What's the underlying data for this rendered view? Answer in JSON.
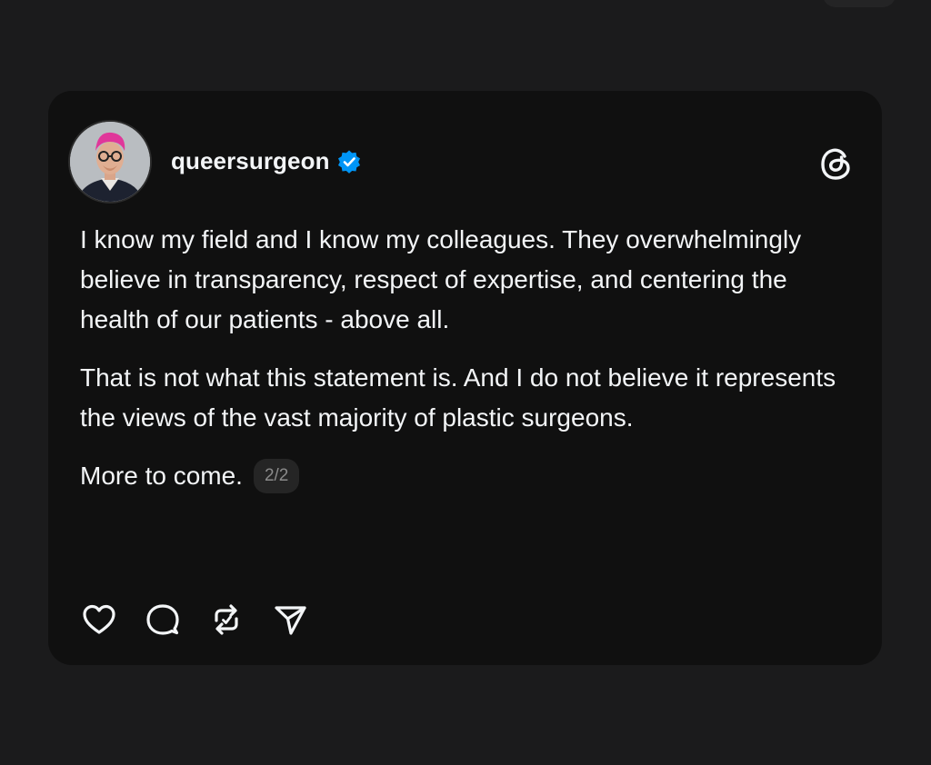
{
  "post": {
    "username": "queersurgeon",
    "verified": true,
    "paragraphs": [
      "I know my field and I know my colleagues. They overwhelmingly believe in transparency, respect of expertise, and centering the health of our patients - above all.",
      "That is not what this statement is. And I do not believe it represents the views of the vast majority of plastic surgeons."
    ],
    "last_line": "More to come.",
    "page_indicator": "2/2"
  },
  "icons": {
    "verified": "verified-badge-icon",
    "app_logo": "threads-logo-icon",
    "like": "heart-icon",
    "reply": "comment-bubble-icon",
    "repost": "repost-icon",
    "share": "send-icon"
  },
  "colors": {
    "background": "#1b1b1c",
    "card": "#101010",
    "text": "#f3f5f7",
    "verified": "#0095f6",
    "badge_bg": "#252525",
    "badge_text": "#8b8b8b"
  }
}
